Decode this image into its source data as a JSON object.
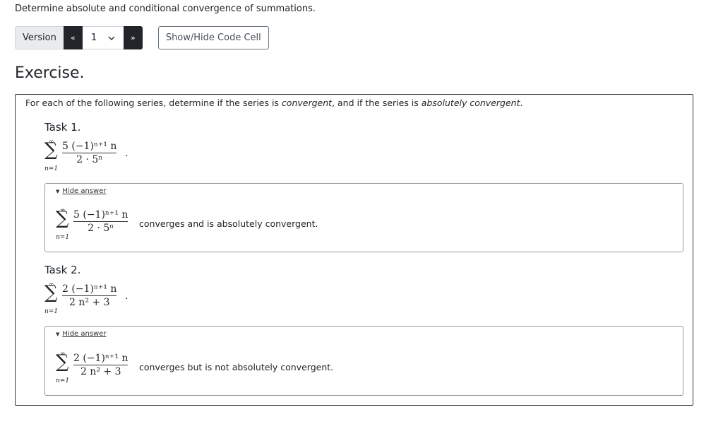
{
  "intro": "Determine absolute and conditional convergence of summations.",
  "toolbar": {
    "version_label": "Version",
    "prev_label": "«",
    "next_label": "»",
    "version_value": "1",
    "code_button_label": "Show/Hide Code Cell"
  },
  "exercise": {
    "title": "Exercise.",
    "statement_before": "For each of the following series, determine if the series is ",
    "statement_em1": "convergent",
    "statement_mid": ", and if the series is ",
    "statement_em2": "absolutely convergent",
    "statement_end": ".",
    "tasks": [
      {
        "title": "Task 1.",
        "sum_upper": "∞",
        "sum_lower": "n=1",
        "numerator": "5 (−1)ⁿ⁺¹ n",
        "denominator": "2 · 5ⁿ",
        "trailing": ".",
        "toggle_label": "Hide answer",
        "answer_text": "converges and is absolutely convergent."
      },
      {
        "title": "Task 2.",
        "sum_upper": "∞",
        "sum_lower": "n=1",
        "numerator": "2 (−1)ⁿ⁺¹ n",
        "denominator": "2 n² + 3",
        "trailing": ".",
        "toggle_label": "Hide answer",
        "answer_text": "converges but is not absolutely convergent."
      }
    ]
  }
}
